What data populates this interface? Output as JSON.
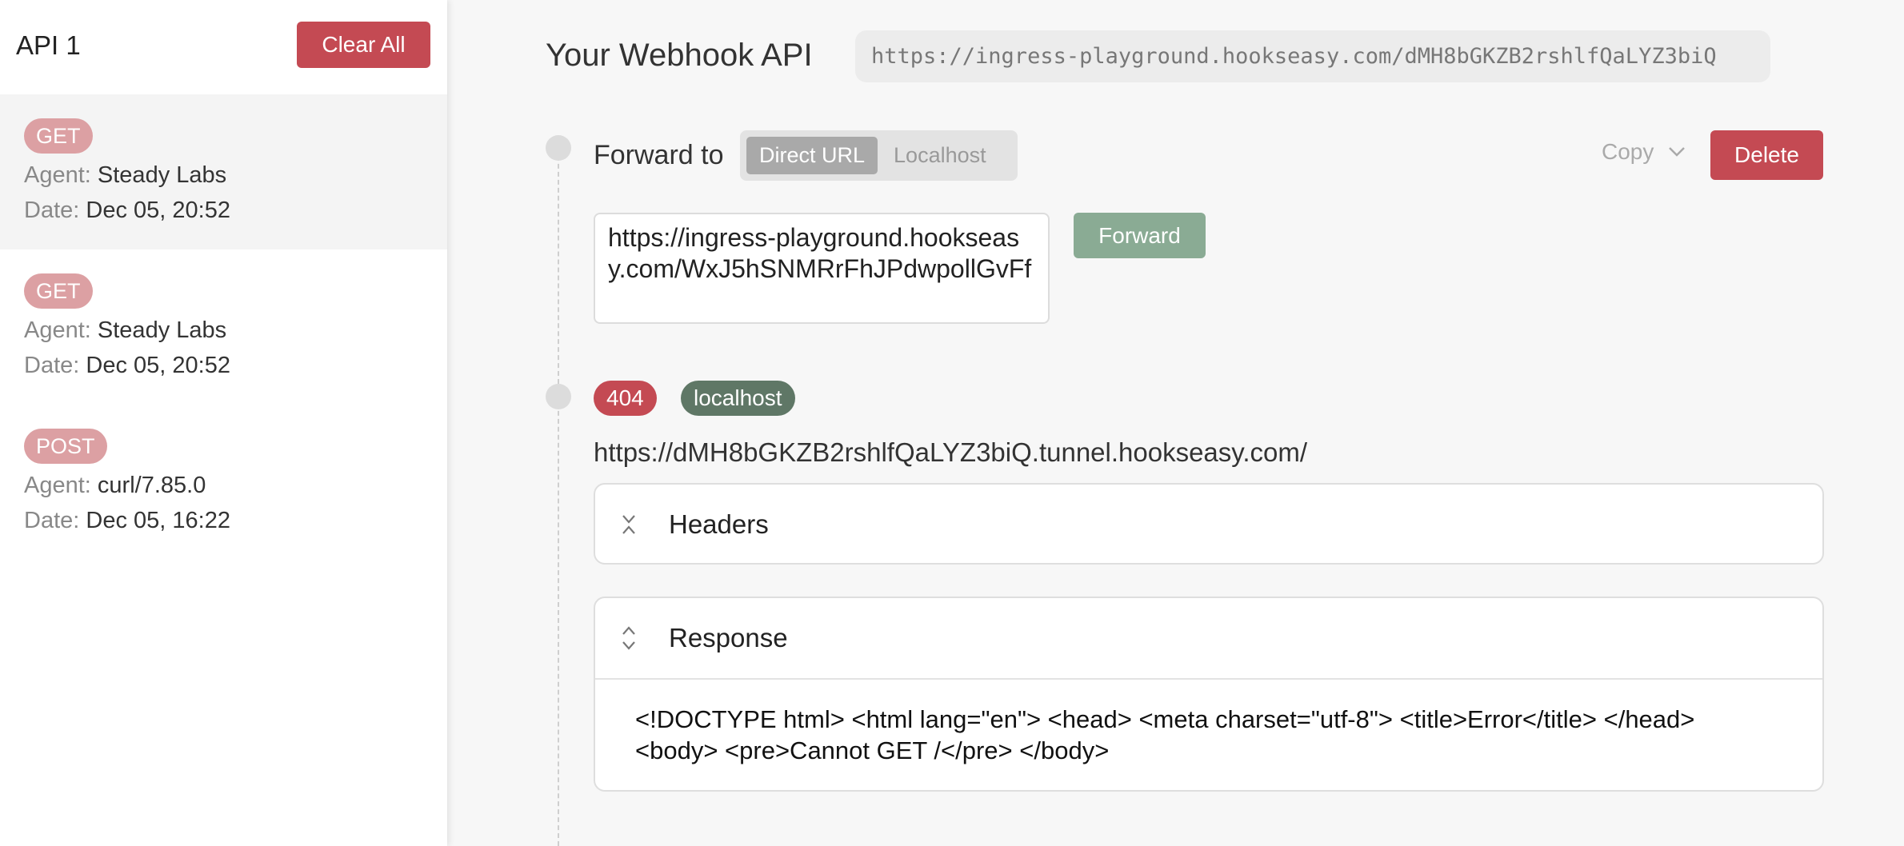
{
  "sidebar": {
    "api_name": "API 1",
    "clear_all_label": "Clear All",
    "agent_label": "Agent:",
    "date_label": "Date:",
    "requests": [
      {
        "method": "GET",
        "agent": "Steady Labs",
        "date": "Dec 05, 20:52"
      },
      {
        "method": "GET",
        "agent": "Steady Labs",
        "date": "Dec 05, 20:52"
      },
      {
        "method": "POST",
        "agent": "curl/7.85.0",
        "date": "Dec 05, 16:22"
      }
    ]
  },
  "main": {
    "webhook_title": "Your Webhook API",
    "webhook_url": "https://ingress-playground.hookseasy.com/dMH8bGKZB2rshlfQaLYZ3biQ",
    "forward": {
      "label": "Forward to",
      "tabs": [
        "Direct URL",
        "Localhost"
      ],
      "copy_label": "Copy",
      "delete_label": "Delete",
      "url_value": "https://ingress-playground.hookseasy.com/WxJ5hSNMRrFhJPdwpollGvFf",
      "forward_button": "Forward"
    },
    "result": {
      "status_code": "404",
      "target": "localhost",
      "url": "https://dMH8bGKZB2rshlfQaLYZ3biQ.tunnel.hookseasy.com/",
      "headers_title": "Headers",
      "response_title": "Response",
      "response_body": "<!DOCTYPE html> <html lang=\"en\"> <head> <meta charset=\"utf-8\"> <title>Error</title> </head> <body> <pre>Cannot GET /</pre> </body>"
    }
  },
  "colors": {
    "danger": "#c44a53",
    "method_badge": "#dca0a3",
    "localhost_badge": "#5f7766",
    "forward_button": "#8aab94"
  },
  "icons": {
    "copy_dropdown": "chevron-down-icon",
    "headers_toggle": "collapse-icon",
    "response_toggle": "expand-icon"
  }
}
